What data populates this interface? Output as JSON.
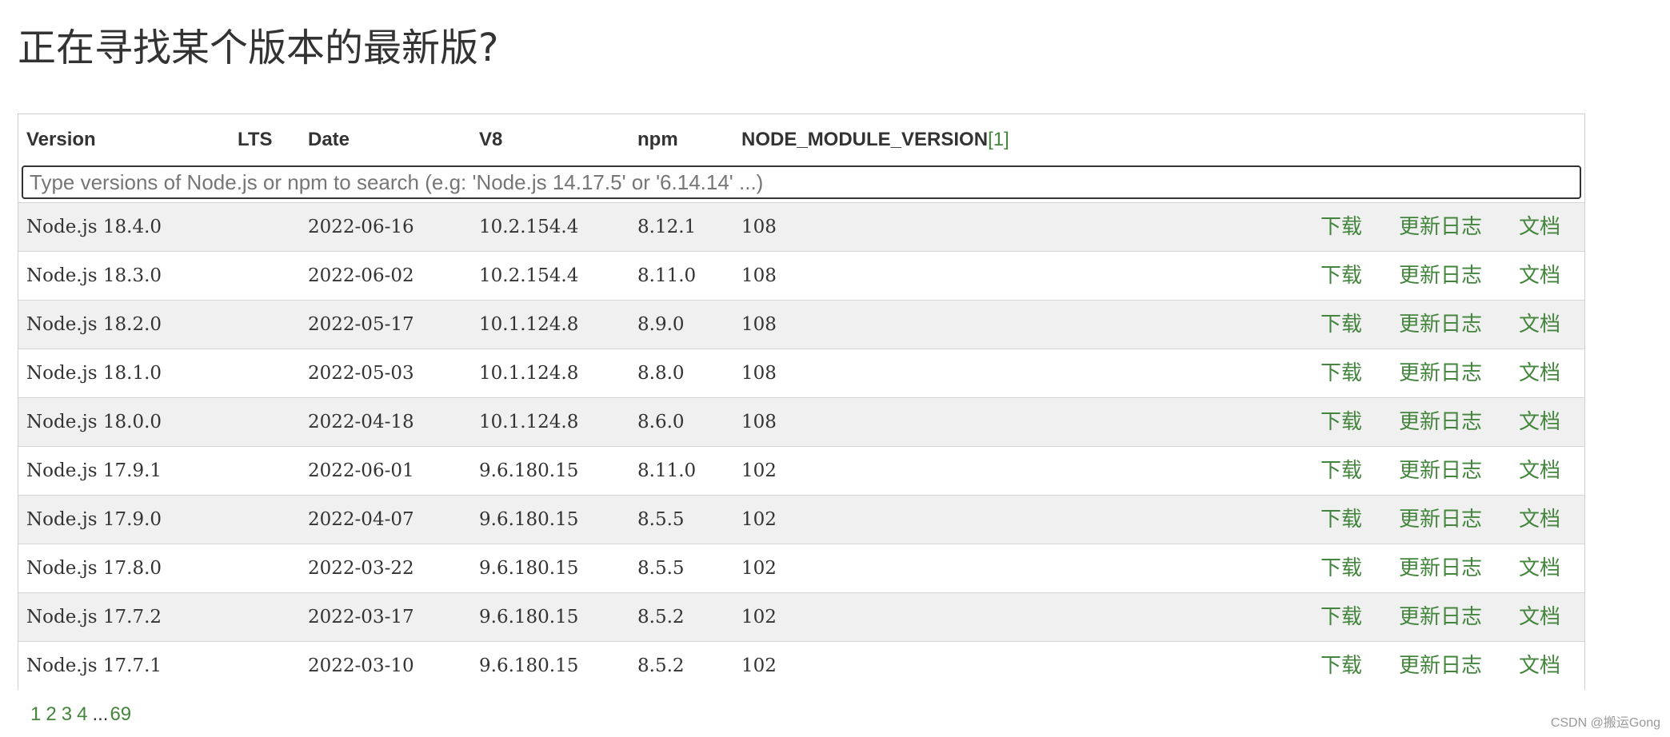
{
  "page": {
    "title": "正在寻找某个版本的最新版?"
  },
  "table": {
    "headers": {
      "version": "Version",
      "lts": "LTS",
      "date": "Date",
      "v8": "V8",
      "npm": "npm",
      "node_module_version": "NODE_MODULE_VERSION",
      "footnote_ref": "[1]"
    },
    "search": {
      "value": "",
      "placeholder": "Type versions of Node.js or npm to search (e.g: 'Node.js 14.17.5' or '6.14.14' ...)"
    },
    "link_labels": {
      "download": "下载",
      "changelog": "更新日志",
      "docs": "文档"
    },
    "rows": [
      {
        "version": "Node.js 18.4.0",
        "lts": "",
        "date": "2022-06-16",
        "v8": "10.2.154.4",
        "npm": "8.12.1",
        "nmv": "108"
      },
      {
        "version": "Node.js 18.3.0",
        "lts": "",
        "date": "2022-06-02",
        "v8": "10.2.154.4",
        "npm": "8.11.0",
        "nmv": "108"
      },
      {
        "version": "Node.js 18.2.0",
        "lts": "",
        "date": "2022-05-17",
        "v8": "10.1.124.8",
        "npm": "8.9.0",
        "nmv": "108"
      },
      {
        "version": "Node.js 18.1.0",
        "lts": "",
        "date": "2022-05-03",
        "v8": "10.1.124.8",
        "npm": "8.8.0",
        "nmv": "108"
      },
      {
        "version": "Node.js 18.0.0",
        "lts": "",
        "date": "2022-04-18",
        "v8": "10.1.124.8",
        "npm": "8.6.0",
        "nmv": "108"
      },
      {
        "version": "Node.js 17.9.1",
        "lts": "",
        "date": "2022-06-01",
        "v8": "9.6.180.15",
        "npm": "8.11.0",
        "nmv": "102"
      },
      {
        "version": "Node.js 17.9.0",
        "lts": "",
        "date": "2022-04-07",
        "v8": "9.6.180.15",
        "npm": "8.5.5",
        "nmv": "102"
      },
      {
        "version": "Node.js 17.8.0",
        "lts": "",
        "date": "2022-03-22",
        "v8": "9.6.180.15",
        "npm": "8.5.5",
        "nmv": "102"
      },
      {
        "version": "Node.js 17.7.2",
        "lts": "",
        "date": "2022-03-17",
        "v8": "9.6.180.15",
        "npm": "8.5.2",
        "nmv": "102"
      },
      {
        "version": "Node.js 17.7.1",
        "lts": "",
        "date": "2022-03-10",
        "v8": "9.6.180.15",
        "npm": "8.5.2",
        "nmv": "102"
      }
    ]
  },
  "pagination": {
    "pages": [
      "1",
      "2",
      "3",
      "4"
    ],
    "ellipsis": "...",
    "last": "69"
  },
  "watermark": "CSDN @搬运Gong",
  "colors": {
    "link": "#43853d",
    "text": "#333333",
    "row_alt": "#f0f0f0"
  }
}
